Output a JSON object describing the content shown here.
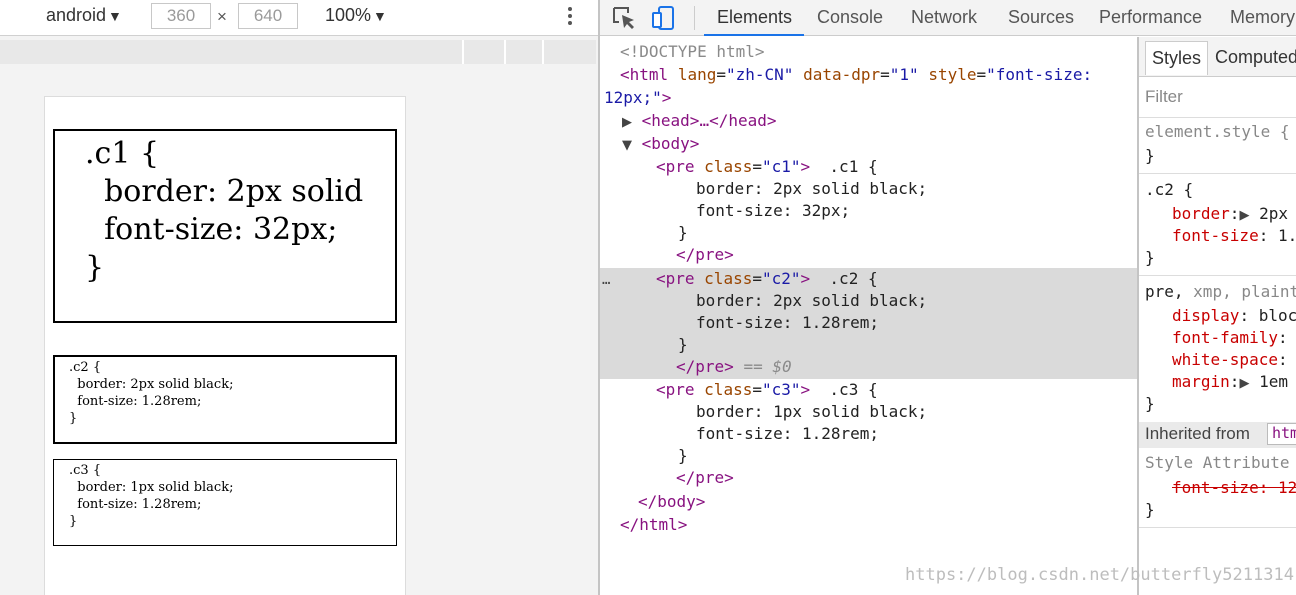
{
  "device_toolbar": {
    "device": "android",
    "width": "360",
    "times": "×",
    "height": "640",
    "zoom": "100%",
    "caret": "▼"
  },
  "preview": {
    "c1_text": ".c1 {\n  border: 2px solid\n  font-size: 32px;\n}",
    "c2_text": ".c2 {\n  border: 2px solid black;\n  font-size: 1.28rem;\n}",
    "c3_text": ".c3 {\n  border: 1px solid black;\n  font-size: 1.28rem;\n}"
  },
  "devtools": {
    "tabs": [
      "Elements",
      "Console",
      "Network",
      "Sources",
      "Performance",
      "Memory"
    ],
    "active_tab": "Elements",
    "accent_color": "#1a73e8"
  },
  "elements_tree": {
    "doctype": "<!DOCTYPE html>",
    "html_open": "<html",
    "attr_lang": "lang",
    "attr_lang_val": "\"zh-CN\"",
    "attr_dpr": "data-dpr",
    "attr_dpr_val": "\"1\"",
    "attr_style": "style",
    "attr_style_val_a": "\"font-size:",
    "attr_style_val_b": "12px;\"",
    "gt": ">",
    "eq": "=",
    "head_collapsed": "<head>…</head>",
    "body_open": "<body>",
    "pre_open": "<pre",
    "class_attr": "class",
    "c1_val": "\"c1\"",
    "c2_val": "\"c2\"",
    "c3_val": "\"c3\"",
    "c1_line1": ".c1 {",
    "c1_line2": "border: 2px solid black;",
    "c1_line3": "font-size: 32px;",
    "c2_line1": ".c2 {",
    "c2_line2": "border: 2px solid black;",
    "c2_line3": "font-size: 1.28rem;",
    "c3_line1": ".c3 {",
    "c3_line2": "border: 1px solid black;",
    "c3_line3": "font-size: 1.28rem;",
    "close_brace": "}",
    "pre_close": "</pre>",
    "selected_marker": "== $0",
    "body_close": "</body>",
    "html_close": "</html>",
    "ellipsis": "…"
  },
  "styles_pane": {
    "tab_styles": "Styles",
    "tab_computed": "Computed",
    "filter_placeholder": "Filter",
    "element_style": "element.style {",
    "brace_close": "}",
    "rule_c2_selector": ".c2 {",
    "rule_c2_border_prop": "border",
    "rule_c2_border_val": "2px",
    "rule_c2_fontsize_prop": "font-size",
    "rule_c2_fontsize_val": "1.",
    "ua_selector_a": "pre,",
    "ua_selector_b": "xmp, plaint",
    "ua_display_prop": "display",
    "ua_display_val": "bloc",
    "ua_fontfamily_prop": "font-family",
    "ua_whitespace_prop": "white-space",
    "ua_margin_prop": "margin",
    "ua_margin_val": "1em",
    "colon": ":",
    "inherited_from": "Inherited from",
    "inherited_chip": "htm",
    "style_attribute": "Style Attribute",
    "style_attr_prop": "font-size: 12"
  },
  "watermark": "https://blog.csdn.net/butterfly5211314"
}
